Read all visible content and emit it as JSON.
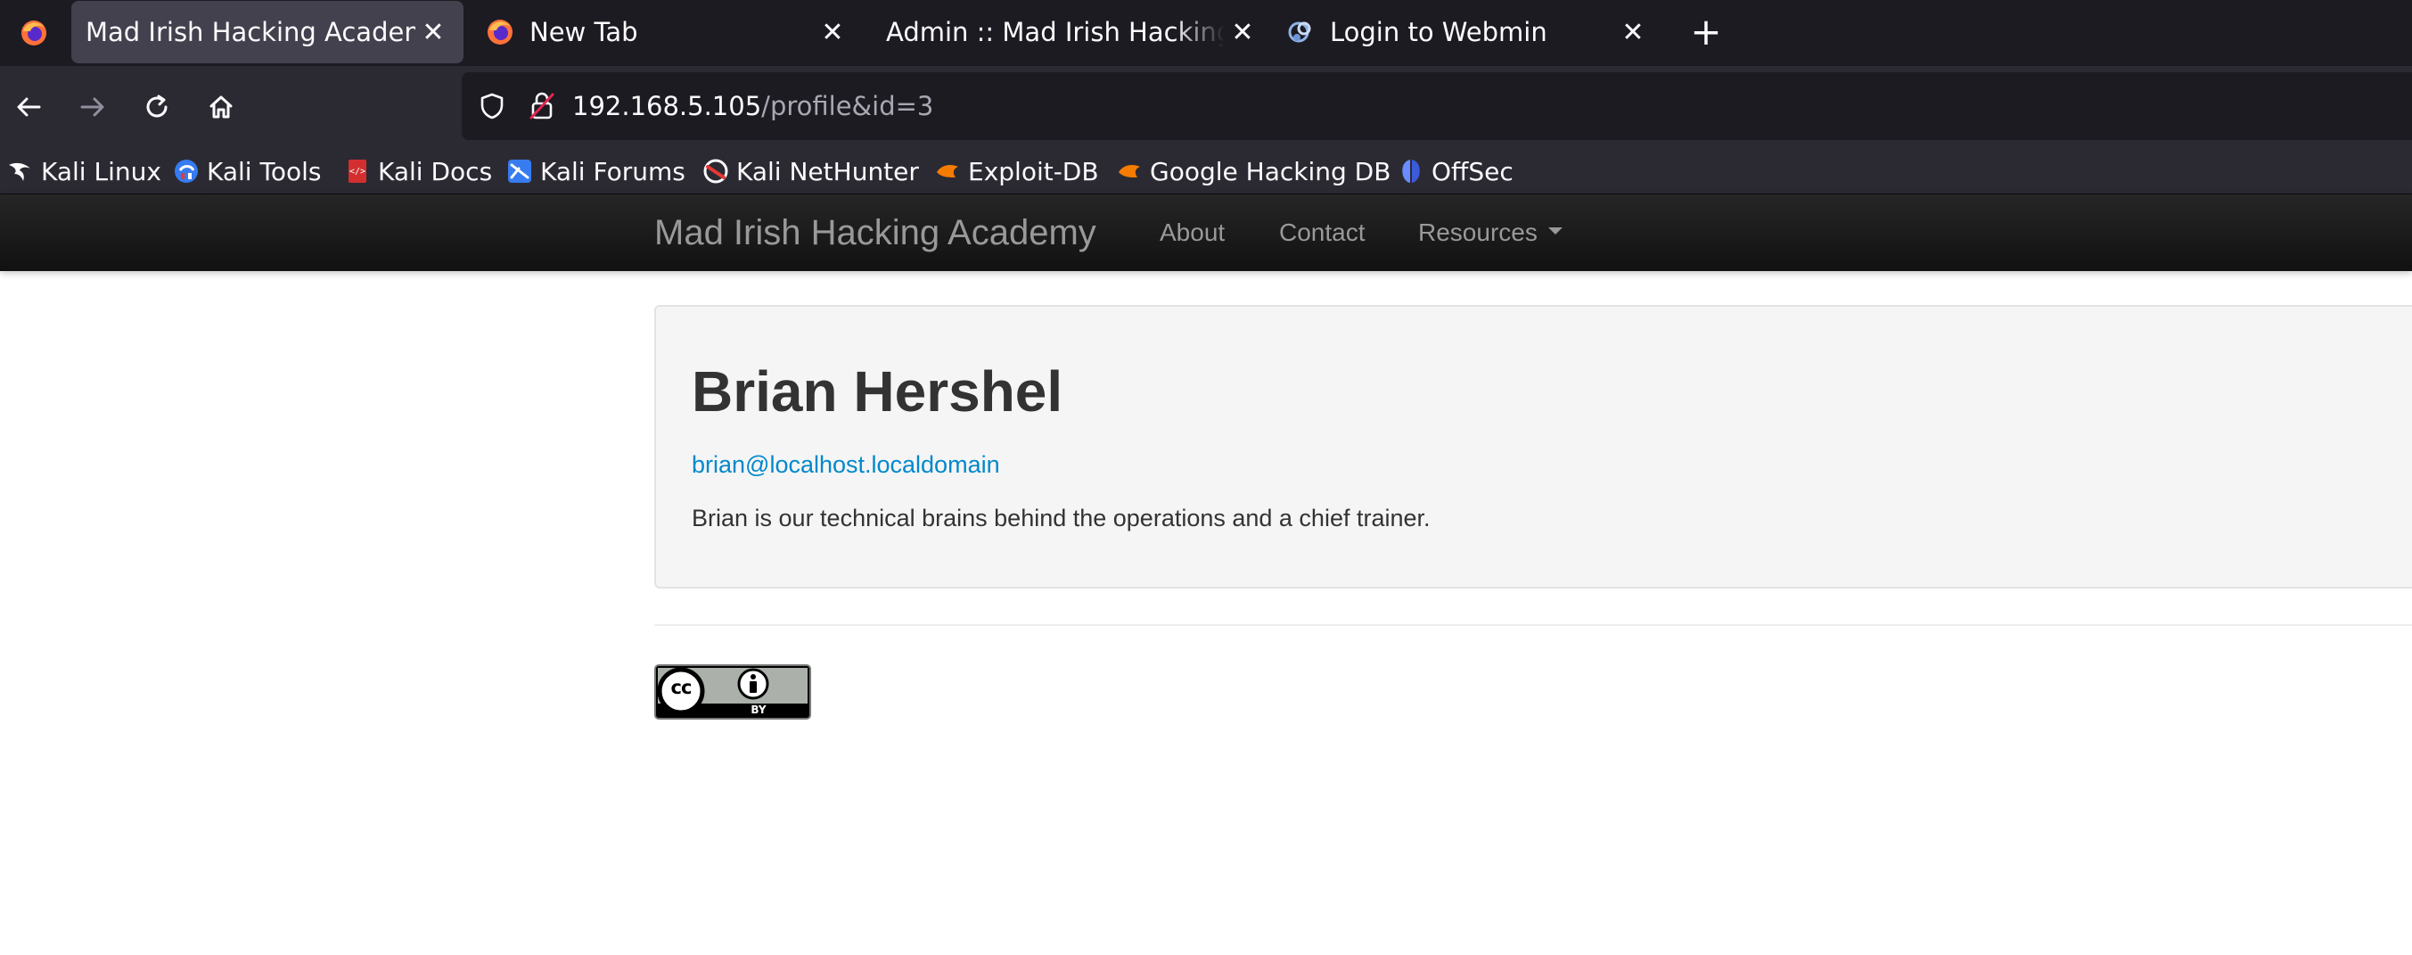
{
  "tabs": [
    {
      "title": "Mad Irish Hacking Academy",
      "active": true,
      "icon": "firefox-dark-icon"
    },
    {
      "title": "New Tab",
      "active": false,
      "icon": "firefox-icon"
    },
    {
      "title": "Admin :: Mad Irish Hacking Academy",
      "active": false,
      "icon": "none"
    },
    {
      "title": "Login to Webmin",
      "active": false,
      "icon": "webmin-icon"
    }
  ],
  "tab_close_glyph": "✕",
  "new_tab_glyph": "+",
  "urlbar": {
    "host": "192.168.5.105",
    "path": "/profile&id=3"
  },
  "bookmarks": [
    {
      "label": "Kali Linux",
      "icon": "kali-dragon-icon"
    },
    {
      "label": "Kali Tools",
      "icon": "kali-tools-icon"
    },
    {
      "label": "Kali Docs",
      "icon": "kali-docs-icon"
    },
    {
      "label": "Kali Forums",
      "icon": "kali-forums-icon"
    },
    {
      "label": "Kali NetHunter",
      "icon": "nethunter-icon"
    },
    {
      "label": "Exploit-DB",
      "icon": "exploitdb-icon"
    },
    {
      "label": "Google Hacking DB",
      "icon": "ghdb-icon"
    },
    {
      "label": "OffSec",
      "icon": "offsec-icon"
    }
  ],
  "site": {
    "brand": "Mad Irish Hacking Academy",
    "nav": [
      "About",
      "Contact",
      "Resources"
    ]
  },
  "profile": {
    "name": "Brian Hershel",
    "email": "brian@localhost.localdomain",
    "bio": "Brian is our technical brains behind the operations and a chief trainer."
  },
  "license_badge": {
    "cc": "cc",
    "by": "BY"
  },
  "colors": {
    "tabstrip_bg": "#1c1b22",
    "toolbar_bg": "#2b2a33",
    "link": "#0088cc",
    "site_nav_bg": "#1b1b1b"
  }
}
